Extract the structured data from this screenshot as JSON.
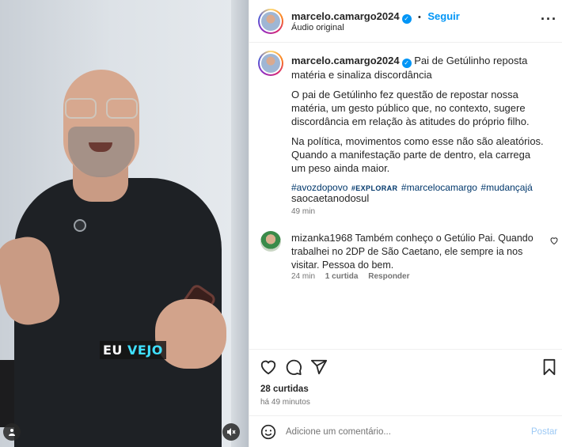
{
  "media": {
    "caption_word1": "EU",
    "caption_word2": "VEJO",
    "icons": [
      "user-tag-icon",
      "mute-icon"
    ]
  },
  "header": {
    "username": "marcelo.camargo2024",
    "separator": "•",
    "follow_label": "Seguir",
    "audio": "Áudio original",
    "more_icon": "more-options-icon"
  },
  "post": {
    "username": "marcelo.camargo2024",
    "title": "Pai de Getúlinho reposta matéria e sinaliza discordância",
    "paragraph1": "O pai de Getúlinho fez questão de repostar nossa matéria, um gesto público que, no contexto, sugere discordância em relação às atitudes do próprio filho.",
    "paragraph2": "Na política, movimentos como esse não são aleatórios. Quando a manifestação parte de dentro, ela carrega um peso ainda maior.",
    "tags": [
      "#avozdopovo",
      "#EXPLORAR",
      "#marcelocamargo",
      "#mudançajá"
    ],
    "tag_line2": "saocaetanodosul",
    "time": "49 min"
  },
  "comment": {
    "username": "mizanka1968",
    "text": "Também conheço o Getúlio Pai. Quando trabalhei no 2DP de São Caetano, ele sempre ia nos visitar. Pessoa do bem.",
    "time": "24 min",
    "likes": "1 curtida",
    "reply": "Responder"
  },
  "actions": {
    "likes": "28 curtidas",
    "posted": "há 49 minutos"
  },
  "add_comment": {
    "placeholder": "Adicione um comentário...",
    "post_label": "Postar"
  },
  "colors": {
    "accent": "#0095f6",
    "hashtag": "#00376b",
    "muted": "#737373",
    "caption_highlight": "#3fe0ff"
  }
}
